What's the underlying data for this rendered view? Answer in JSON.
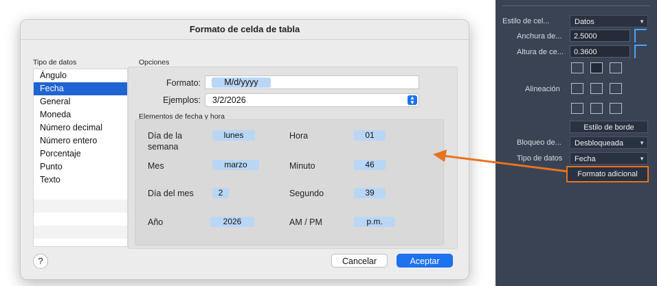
{
  "dialog": {
    "title": "Formato de celda de tabla",
    "data_types_label": "Tipo de datos",
    "data_types": [
      "Ángulo",
      "Fecha",
      "General",
      "Moneda",
      "Número decimal",
      "Número entero",
      "Porcentaje",
      "Punto",
      "Texto"
    ],
    "selected_type": "Fecha",
    "options_label": "Opciones",
    "format_label": "Formato:",
    "format_value": "M/d/yyyy",
    "examples_label": "Ejemplos:",
    "examples_value": "3/2/2026",
    "elements_label": "Elementos de fecha y hora",
    "elements": {
      "day_of_week_label": "Día de la semana",
      "day_of_week_value": "lunes",
      "month_label": "Mes",
      "month_value": "marzo",
      "day_of_month_label": "Día del mes",
      "day_of_month_value": "2",
      "year_label": "Año",
      "year_value": "2026",
      "hour_label": "Hora",
      "hour_value": "01",
      "minute_label": "Minuto",
      "minute_value": "46",
      "second_label": "Segundo",
      "second_value": "39",
      "ampm_label": "AM / PM",
      "ampm_value": "p.m."
    },
    "help_label": "?",
    "cancel_label": "Cancelar",
    "accept_label": "Aceptar"
  },
  "palette": {
    "cell_style_label": "Estilo de cel...",
    "cell_style_value": "Datos",
    "cell_width_label": "Anchura de...",
    "cell_width_value": "2.5000",
    "cell_height_label": "Altura de ce...",
    "cell_height_value": "0.3600",
    "alignment_label": "Alineación",
    "border_style_label": "Estilo de borde",
    "lock_label": "Bloqueo de...",
    "lock_value": "Desbloqueada",
    "data_type_label": "Tipo de datos",
    "data_type_value": "Fecha",
    "additional_format_label": "Formato adicional"
  },
  "colors": {
    "accent": "#1d72f0",
    "selection": "#1f64d2",
    "chip": "#b9d6f5",
    "arrow": "#e8731e",
    "palette_bg": "#3a4354"
  }
}
